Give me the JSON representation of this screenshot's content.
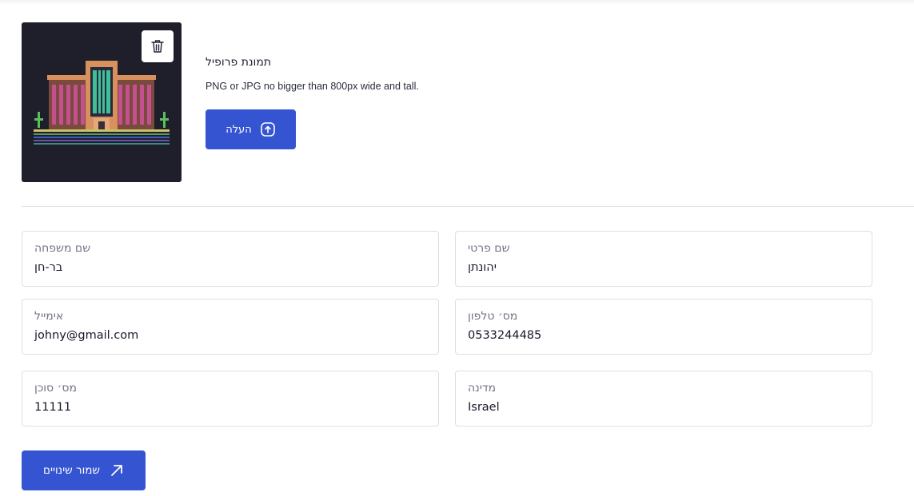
{
  "profile_photo": {
    "title": "תמונת פרופיל",
    "hint": "PNG or JPG no bigger than 800px wide and tall.",
    "upload_label": "העלה",
    "delete_icon": "trash-icon",
    "upload_icon": "upload-circle-icon"
  },
  "form": {
    "last_name": {
      "label": "שם משפחה",
      "value": "בר-חן"
    },
    "first_name": {
      "label": "שם פרטי",
      "value": "יהונתן"
    },
    "email": {
      "label": "אימייל",
      "value": "johny@gmail.com"
    },
    "phone": {
      "label": "מס׳ טלפון",
      "value": "0533244485"
    },
    "agent_number": {
      "label": "מס׳ סוכן",
      "value": "11111"
    },
    "country": {
      "label": "מדינה",
      "value": "Israel"
    }
  },
  "save_button": {
    "label": "שמור שינויים",
    "icon": "arrow-up-right-icon"
  },
  "colors": {
    "primary": "#3554d1",
    "avatar_bg": "#1f1e2b",
    "border": "#dddfe4"
  }
}
